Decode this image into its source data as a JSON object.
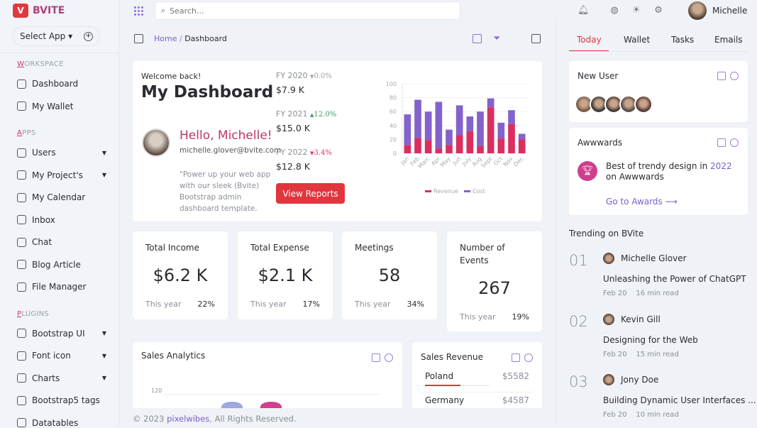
{
  "brand": {
    "name": "BVITE",
    "logo_letter": "V"
  },
  "sidebar": {
    "select_app": "Select App",
    "sections": [
      {
        "title": "WORKSPACE",
        "items": [
          {
            "label": "Dashboard",
            "icon": "home-icon"
          },
          {
            "label": "My Wallet",
            "icon": "wallet-icon"
          }
        ]
      },
      {
        "title": "APPS",
        "items": [
          {
            "label": "Users",
            "icon": "user-icon",
            "caret": true
          },
          {
            "label": "My Project's",
            "icon": "project-icon",
            "caret": true
          },
          {
            "label": "My Calendar",
            "icon": "calendar-icon"
          },
          {
            "label": "Inbox",
            "icon": "inbox-icon"
          },
          {
            "label": "Chat",
            "icon": "chat-icon"
          },
          {
            "label": "Blog Article",
            "icon": "blog-icon"
          },
          {
            "label": "File Manager",
            "icon": "folder-icon"
          }
        ]
      },
      {
        "title": "PLUGINS",
        "items": [
          {
            "label": "Bootstrap UI",
            "icon": "bootstrap-icon",
            "caret": true
          },
          {
            "label": "Font icon",
            "icon": "font-icon",
            "caret": true
          },
          {
            "label": "Charts",
            "icon": "chart-icon",
            "caret": true
          },
          {
            "label": "Bootstrap5 tags",
            "icon": "tag-icon"
          },
          {
            "label": "Datatables",
            "icon": "table-icon"
          }
        ]
      }
    ]
  },
  "topbar": {
    "search_placeholder": "Search...",
    "user": "Michelle"
  },
  "breadcrumb": {
    "home": "Home",
    "current": "Dashboard"
  },
  "welcome": {
    "greeting": "Welcome back!",
    "title": "My Dashboard",
    "hello": "Hello, Michelle!",
    "email": "michelle.glover@bvite.com",
    "quote": "\"Power up your web app with our sleek (Bvite) Bootstrap admin dashboard template.",
    "button": "View Reports"
  },
  "fy": [
    {
      "label": "FY 2020",
      "change": "0.0%",
      "dir": "flat",
      "value": "$7.9 K",
      "color": "#9aa0a8"
    },
    {
      "label": "FY 2021",
      "change": "12.0%",
      "dir": "up",
      "value": "$15.0 K",
      "color": "#3a9d64"
    },
    {
      "label": "FY 2022",
      "change": "3.4%",
      "dir": "down",
      "value": "$12.8 K",
      "color": "#e0365a"
    }
  ],
  "chart_data": {
    "type": "bar",
    "stacked": true,
    "categories": [
      "Jan",
      "Feb",
      "Marc",
      "Apr",
      "May",
      "Jun",
      "July",
      "Aug",
      "Sept",
      "Oct",
      "Nov",
      "Dec"
    ],
    "series": [
      {
        "name": "Revenue",
        "color": "#d92f5e",
        "values": [
          12,
          22,
          19,
          7,
          12,
          26,
          32,
          11,
          66,
          21,
          42,
          20
        ]
      },
      {
        "name": "Cost",
        "color": "#8462cc",
        "values": [
          44,
          55,
          41,
          67,
          22,
          43,
          21,
          49,
          13,
          23,
          20,
          8
        ]
      }
    ],
    "ylim": [
      0,
      100
    ],
    "yticks": [
      "0",
      "20",
      "40",
      "60",
      "80",
      "100"
    ],
    "grid": true,
    "legend": "bottom"
  },
  "stats": [
    {
      "title": "Total Income",
      "value": "$6.2 K",
      "foot": "This year",
      "pct": "22%"
    },
    {
      "title": "Total Expense",
      "value": "$2.1 K",
      "foot": "This year",
      "pct": "17%"
    },
    {
      "title": "Meetings",
      "value": "58",
      "foot": "This year",
      "pct": "34%"
    },
    {
      "title": "Number of Events",
      "value": "267",
      "foot": "This year",
      "pct": "19%"
    }
  ],
  "sales_analytics": {
    "title": "Sales Analytics",
    "ytick": "120"
  },
  "sales_revenue": {
    "title": "Sales Revenue",
    "rows": [
      {
        "country": "Poland",
        "value": "$5582",
        "progress": 55
      },
      {
        "country": "Germany",
        "value": "$4587"
      }
    ]
  },
  "footer": {
    "pre": "© 2023 ",
    "link": "pixelwibes",
    "post": ", All Rights Reserved."
  },
  "right": {
    "tabs": [
      "Today",
      "Wallet",
      "Tasks",
      "Emails"
    ],
    "active_tab": "Today",
    "new_user": {
      "title": "New User",
      "avatars": [
        "#7a5a48",
        "#3c3a3a",
        "#4a3b35",
        "#55504a",
        "#5a3a3a"
      ]
    },
    "awards": {
      "title": "Awwwards",
      "text_pre": "Best of trendy design in ",
      "year": "2022",
      "text_post": " on Awwwards",
      "link": "Go to Awards"
    },
    "trending_title": "Trending on BVite",
    "trending": [
      {
        "num": "01",
        "author": "Michelle Glover",
        "title": "Unleashing the Power of ChatGPT",
        "date": "Feb 20",
        "read": "16 min read"
      },
      {
        "num": "02",
        "author": "Kevin Gill",
        "title": "Designing for the Web",
        "date": "Feb 20",
        "read": "15 min read"
      },
      {
        "num": "03",
        "author": "Jony Doe",
        "title": "Building Dynamic User Interfaces ...",
        "date": "Feb 20",
        "read": "10 min read"
      }
    ]
  }
}
